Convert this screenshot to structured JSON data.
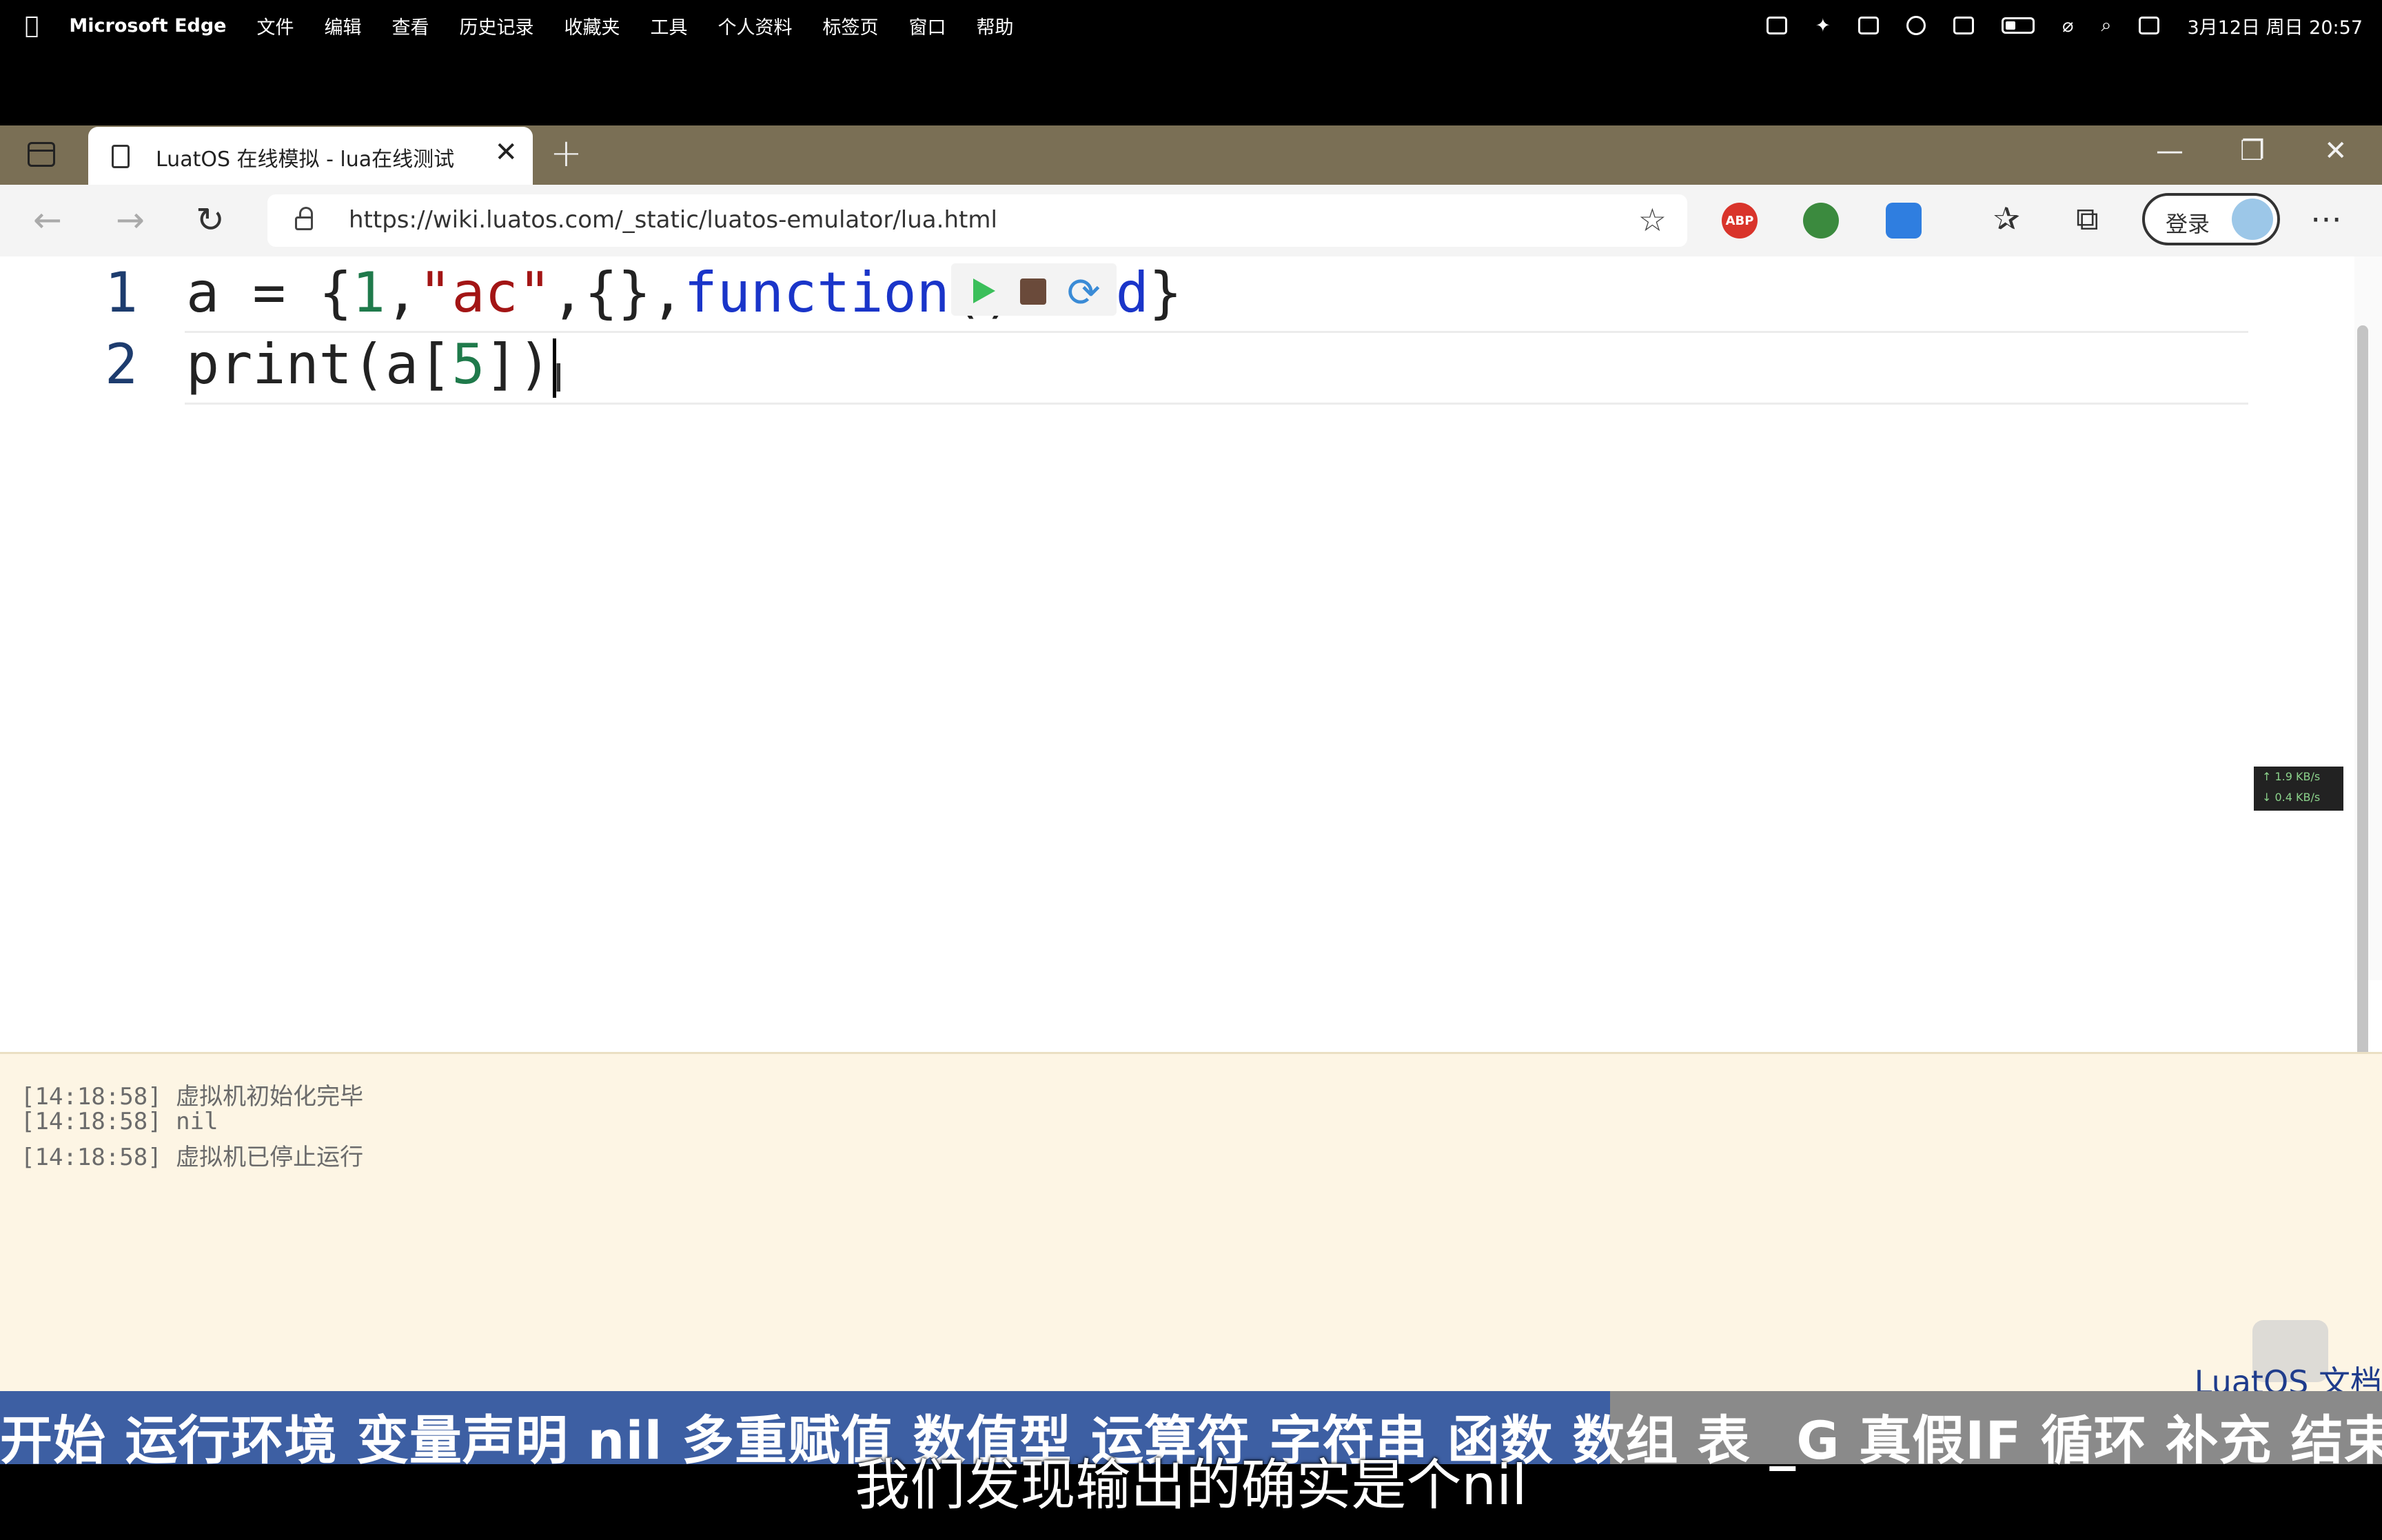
{
  "menubar": {
    "app_name": "Microsoft Edge",
    "items": [
      "文件",
      "编辑",
      "查看",
      "历史记录",
      "收藏夹",
      "工具",
      "个人资料",
      "标签页",
      "窗口",
      "帮助"
    ],
    "clock": "3月12日 周日 20:57"
  },
  "browser": {
    "tab_title": "LuatOS 在线模拟 - lua在线测试",
    "url": "https://wiki.luatos.com/_static/luatos-emulator/lua.html",
    "signin_label": "登录",
    "adblock_label": "ABP"
  },
  "editor": {
    "line_numbers": [
      "1",
      "2"
    ],
    "line1": {
      "a": "a",
      "eq": "=",
      "open": "{",
      "num1": "1",
      "c1": ",",
      "str": "\"ac\"",
      "c2": ",",
      "tbl": "{}",
      "c3": ",",
      "fn": "function",
      "parens": "()",
      "end_kw": "end",
      "close": "}"
    },
    "line2": {
      "print": "print(",
      "a": "a[",
      "num": "5",
      "close": "])"
    }
  },
  "network": {
    "up": "↑ 1.9 KB/s",
    "down": "↓ 0.4 KB/s"
  },
  "console": {
    "logs": [
      "[14:18:58] 虚拟机初始化完毕",
      "[14:18:58] nil",
      "[14:18:58] 虚拟机已停止运行"
    ],
    "doc_link": "LuatOS 文档"
  },
  "video": {
    "chapters": "开始 运行环境 变量声明 nil 多重赋值 数值型 运算符 字符串 函数 数组 表 _G 真假IF 循环 补充 结束",
    "subtitle": "我们发现输出的确实是个nil",
    "played_fraction": 0.676
  },
  "colors": {
    "tab_bar": "#7a6f55",
    "console_bg": "#fdf5e4",
    "chapter_played": "#3d5fa3",
    "keyword": "#1a35c9",
    "number": "#1f7a4b",
    "string": "#a31515"
  }
}
